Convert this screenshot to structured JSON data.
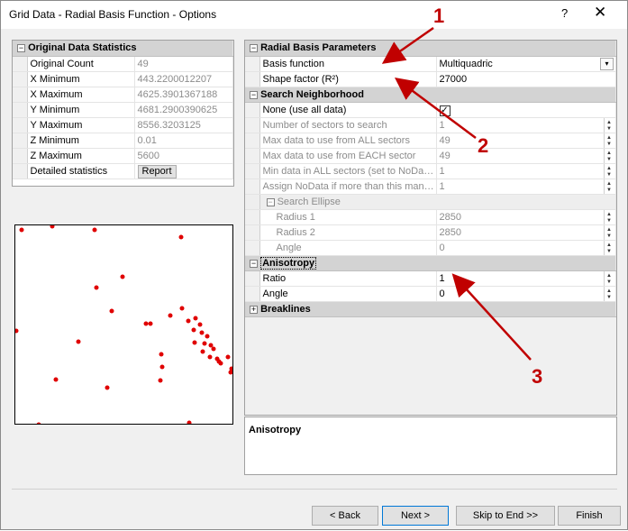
{
  "window": {
    "title": "Grid Data - Radial Basis Function - Options",
    "help": "?",
    "close": "✕"
  },
  "stats": {
    "header": "Original Data Statistics",
    "rows": [
      {
        "label": "Original Count",
        "value": "49"
      },
      {
        "label": "X Minimum",
        "value": "443.2200012207"
      },
      {
        "label": "X Maximum",
        "value": "4625.3901367188"
      },
      {
        "label": "Y Minimum",
        "value": "4681.2900390625"
      },
      {
        "label": "Y Maximum",
        "value": "8556.3203125"
      },
      {
        "label": "Z Minimum",
        "value": "0.01"
      },
      {
        "label": "Z Maximum",
        "value": "5600"
      }
    ],
    "detailed_label": "Detailed statistics",
    "report_button": "Report"
  },
  "props": {
    "rbp": {
      "header": "Radial Basis Parameters",
      "basis_label": "Basis function",
      "basis_value": "Multiquadric",
      "shape_label": "Shape factor (R²)",
      "shape_value": "27000"
    },
    "search": {
      "header": "Search Neighborhood",
      "none_label": "None (use all data)",
      "sectors_label": "Number of sectors to search",
      "sectors_value": "1",
      "maxall_label": "Max data to use from ALL sectors",
      "maxall_value": "49",
      "maxeach_label": "Max data to use from EACH sector",
      "maxeach_value": "49",
      "minall_label": "Min data in ALL sectors (set to NoData if less)",
      "minall_value": "1",
      "assign_label": "Assign NoData if more than this many sectors are empty",
      "assign_value": "1",
      "ellipse_header": "Search Ellipse",
      "r1_label": "Radius 1",
      "r1_value": "2850",
      "r2_label": "Radius 2",
      "r2_value": "2850",
      "angle_label": "Angle",
      "angle_value": "0"
    },
    "aniso": {
      "header": "Anisotropy",
      "ratio_label": "Ratio",
      "ratio_value": "1",
      "angle_label": "Angle",
      "angle_value": "0"
    },
    "breaklines": {
      "header": "Breaklines"
    }
  },
  "description": {
    "title": "Anisotropy"
  },
  "buttons": {
    "back": "< Back",
    "next": "Next >",
    "skip": "Skip to End >>",
    "finish": "Finish"
  },
  "annotations": [
    "1",
    "2",
    "3"
  ],
  "colors": {
    "dot": "#e00000",
    "arrow": "#c00000"
  }
}
